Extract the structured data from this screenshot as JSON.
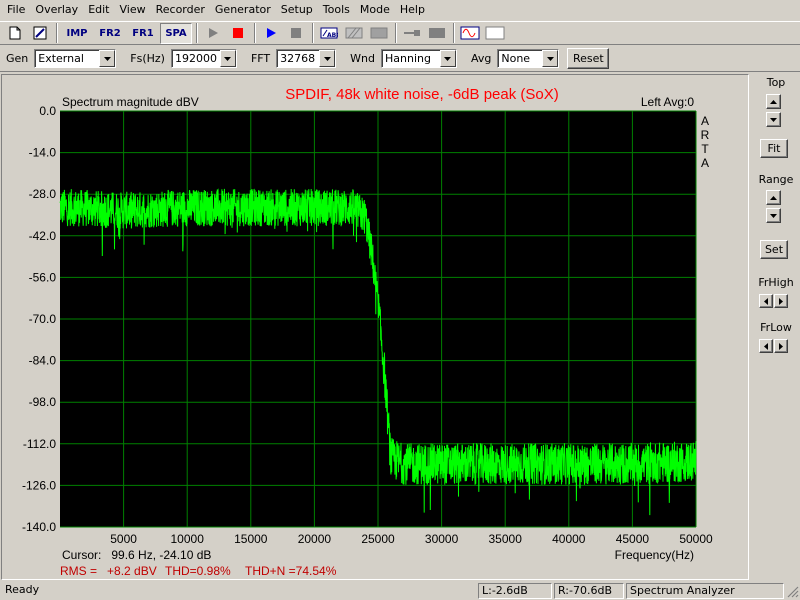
{
  "menu": [
    "File",
    "Overlay",
    "Edit",
    "View",
    "Recorder",
    "Generator",
    "Setup",
    "Tools",
    "Mode",
    "Help"
  ],
  "toolbar": {
    "imp_label": "IMP",
    "fr2_label": "FR2",
    "fr1_label": "FR1",
    "spa_label": "SPA"
  },
  "controls": {
    "gen_label": "Gen",
    "gen_value": "External",
    "fs_label": "Fs(Hz)",
    "fs_value": "192000",
    "fft_label": "FFT",
    "fft_value": "32768",
    "wnd_label": "Wnd",
    "wnd_value": "Hanning",
    "avg_label": "Avg",
    "avg_value": "None",
    "reset_label": "Reset"
  },
  "right_panel": {
    "top_label": "Top",
    "fit_label": "Fit",
    "range_label": "Range",
    "set_label": "Set",
    "frhigh_label": "FrHigh",
    "frlow_label": "FrLow"
  },
  "chart_data": {
    "type": "line",
    "title": "SPDIF, 48k white noise, -6dB peak (SoX)",
    "ylabel": "Spectrum magnitude dBV",
    "xlabel": "Frequency(Hz)",
    "channel_label": "Left Avg:0",
    "watermark": "ARTA",
    "xlim": [
      0,
      50000
    ],
    "ylim": [
      -140,
      0
    ],
    "x_ticks": [
      5000,
      10000,
      15000,
      20000,
      25000,
      30000,
      35000,
      40000,
      45000,
      50000
    ],
    "y_ticks": [
      "0.0",
      "-14.0",
      "-28.0",
      "-42.0",
      "-56.0",
      "-70.0",
      "-84.0",
      "-98.0",
      "-112.0",
      "-126.0",
      "-140.0"
    ],
    "grid": true,
    "colors": {
      "background": "#000000",
      "grid": "#008000",
      "trace": "#00ff00",
      "title": "#ff0000",
      "measurement": "#c00000"
    },
    "series": [
      {
        "x": [
          0,
          1000,
          5000,
          10000,
          15000,
          20000,
          22000,
          23000,
          24000,
          24500,
          25000,
          25500,
          26000,
          27000,
          30000,
          35000,
          40000,
          45000,
          50000
        ],
        "y": [
          -30,
          -30,
          -31,
          -30,
          -30,
          -30,
          -30,
          -30,
          -33,
          -45,
          -62,
          -85,
          -114,
          -116,
          -116,
          -116,
          -116,
          -116,
          -115
        ]
      }
    ],
    "cursor_text": "Cursor:   99.6 Hz, -24.10 dB",
    "rms_text": "RMS =   +8.2 dBV",
    "thd_text": "THD=0.98%",
    "thdn_text": "THD+N =74.54%"
  },
  "status": {
    "ready": "Ready",
    "left": "L:-2.6dB",
    "right": "R:-70.6dB",
    "mode": "Spectrum Analyzer"
  }
}
